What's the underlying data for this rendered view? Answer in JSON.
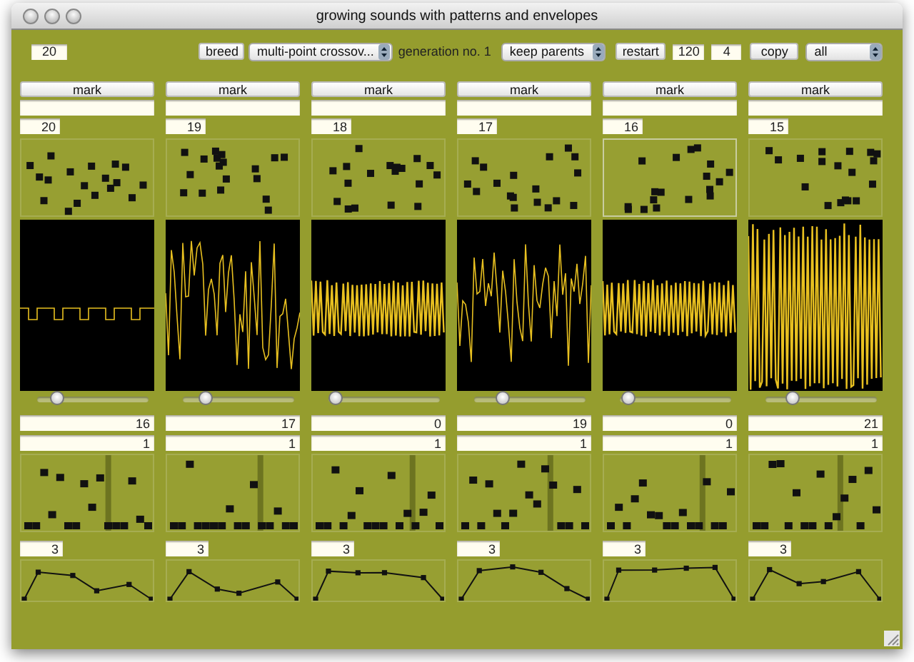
{
  "window": {
    "title": "growing sounds with patterns and envelopes"
  },
  "toolbar": {
    "population": "20",
    "breed_button": "breed",
    "crossover": "multi-point crossov...",
    "generation": "generation no. 1",
    "parents": "keep parents",
    "restart_button": "restart",
    "field_1": "120",
    "field_2": "4",
    "copy_button": "copy",
    "copy_target": "all"
  },
  "individuals": [
    {
      "mark_button": "mark",
      "number": "20",
      "selected": false,
      "level": 0.18,
      "value_1": "16",
      "value_2": "1",
      "value_3": "3"
    },
    {
      "mark_button": "mark",
      "number": "19",
      "selected": false,
      "level": 0.2,
      "value_1": "17",
      "value_2": "1",
      "value_3": "3"
    },
    {
      "mark_button": "mark",
      "number": "18",
      "selected": false,
      "level": 0.07,
      "value_1": "0",
      "value_2": "1",
      "value_3": "3"
    },
    {
      "mark_button": "mark",
      "number": "17",
      "selected": false,
      "level": 0.26,
      "value_1": "19",
      "value_2": "1",
      "value_3": "3"
    },
    {
      "mark_button": "mark",
      "number": "16",
      "selected": true,
      "level": 0.08,
      "value_1": "0",
      "value_2": "1",
      "value_3": "3"
    },
    {
      "mark_button": "mark",
      "number": "15",
      "selected": false,
      "level": 0.24,
      "value_1": "21",
      "value_2": "1",
      "value_3": "3"
    }
  ]
}
